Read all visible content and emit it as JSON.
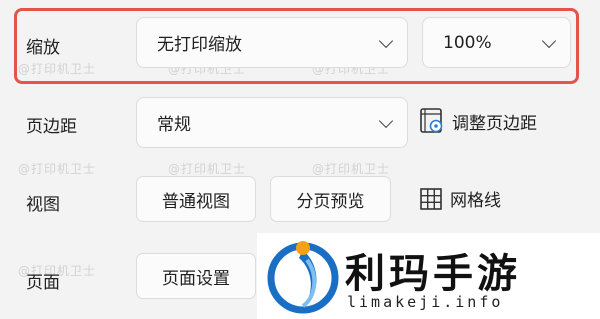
{
  "watermark": "@打印机卫士",
  "zoom": {
    "label": "缩放",
    "scale_value": "无打印缩放",
    "percent_value": "100%"
  },
  "margins": {
    "label": "页边距",
    "value": "常规",
    "adjust_label": "调整页边距"
  },
  "view": {
    "label": "视图",
    "normal_button": "普通视图",
    "page_break_button": "分页预览",
    "gridlines_label": "网格线"
  },
  "page": {
    "label": "页面",
    "setup_button": "页面设置"
  },
  "logo": {
    "title": "利玛手游",
    "url": "limakeji.info"
  },
  "colors": {
    "highlight": "#e4544c",
    "logo_blue": "#1a6fc4",
    "logo_orange": "#f4a019"
  }
}
